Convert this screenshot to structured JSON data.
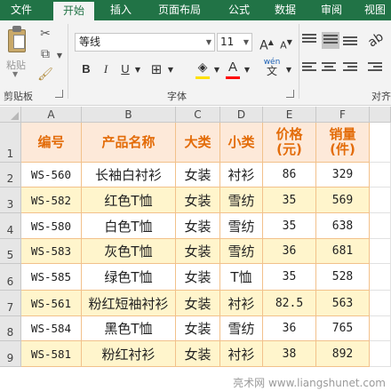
{
  "ribbon_tabs": [
    "文件",
    "开始",
    "插入",
    "页面布局",
    "公式",
    "数据",
    "审阅",
    "视图"
  ],
  "active_tab": "开始",
  "clipboard": {
    "paste_label": "粘贴",
    "group_label": "剪贴板"
  },
  "font": {
    "name": "等线",
    "size": "11",
    "group_label": "字体",
    "fill_color": "#ffe100",
    "font_color": "#ff0000"
  },
  "alignment": {
    "group_label": "对齐"
  },
  "grid": {
    "column_letters": [
      "A",
      "B",
      "C",
      "D",
      "E",
      "F"
    ],
    "row_numbers": [
      "1",
      "2",
      "3",
      "4",
      "5",
      "6",
      "7",
      "8",
      "9"
    ],
    "headers": [
      "编号",
      "产品名称",
      "大类",
      "小类",
      "价格\n(元)",
      "销量\n(件)"
    ],
    "rows": [
      [
        "WS-560",
        "长袖白衬衫",
        "女装",
        "衬衫",
        "86",
        "329"
      ],
      [
        "WS-582",
        "红色T恤",
        "女装",
        "雪纺",
        "35",
        "569"
      ],
      [
        "WS-580",
        "白色T恤",
        "女装",
        "雪纺",
        "35",
        "638"
      ],
      [
        "WS-583",
        "灰色T恤",
        "女装",
        "雪纺",
        "36",
        "681"
      ],
      [
        "WS-585",
        "绿色T恤",
        "女装",
        "T恤",
        "35",
        "528"
      ],
      [
        "WS-561",
        "粉红短袖衬衫",
        "女装",
        "衬衫",
        "82.5",
        "563"
      ],
      [
        "WS-584",
        "黑色T恤",
        "女装",
        "雪纺",
        "36",
        "765"
      ],
      [
        "WS-581",
        "粉红衬衫",
        "女装",
        "衬衫",
        "38",
        "892"
      ]
    ]
  },
  "colors": {
    "ribbon_green": "#217346",
    "header_fill": "#fde9d9",
    "header_text": "#e36c09",
    "band_fill": "#fff5cc",
    "border": "#f2c18b"
  },
  "watermark": "亮术网 www.liangshunet.com"
}
